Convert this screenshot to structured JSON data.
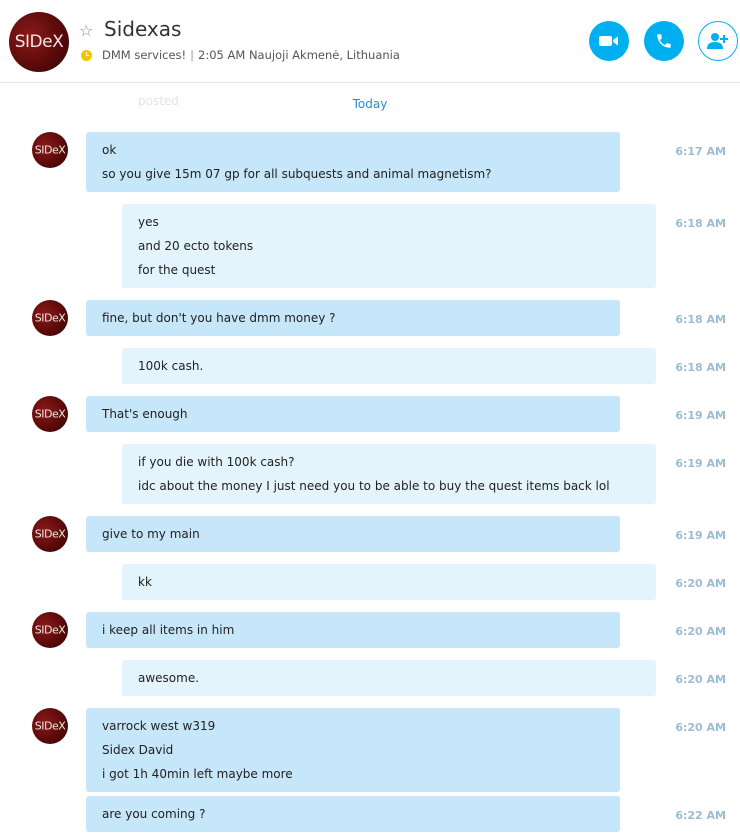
{
  "header": {
    "avatar_text": "SIDeX",
    "name": "Sidexas",
    "status": "DMM services!",
    "local_time": "2:05 AM Naujoji Akmenė, Lithuania",
    "buttons": [
      "video-call",
      "voice-call",
      "add-people"
    ]
  },
  "conversation": {
    "ghost_text": "posted",
    "date_divider": "Today",
    "avatar_text": "SIDeX",
    "messages": [
      {
        "dir": "in",
        "lines": [
          "ok",
          "so you give 15m 07 gp for all subquests and animal magnetism?"
        ],
        "time": "6:17 AM"
      },
      {
        "dir": "out",
        "lines": [
          "yes",
          "and 20 ecto tokens",
          "for the quest"
        ],
        "time": "6:18 AM"
      },
      {
        "dir": "in",
        "lines": [
          "fine, but don't you have dmm money ?"
        ],
        "time": "6:18 AM"
      },
      {
        "dir": "out",
        "lines": [
          "100k cash."
        ],
        "time": "6:18 AM"
      },
      {
        "dir": "in",
        "lines": [
          "That's enough"
        ],
        "time": "6:19 AM"
      },
      {
        "dir": "out",
        "lines": [
          "if you die with 100k cash?",
          "idc about the money I just need you to be able to buy the quest items back lol"
        ],
        "time": "6:19 AM"
      },
      {
        "dir": "in",
        "lines": [
          "give to my main"
        ],
        "time": "6:19 AM"
      },
      {
        "dir": "out",
        "lines": [
          "kk"
        ],
        "time": "6:20 AM"
      },
      {
        "dir": "in",
        "lines": [
          "i keep all items in him"
        ],
        "time": "6:20 AM"
      },
      {
        "dir": "out",
        "lines": [
          "awesome."
        ],
        "time": "6:20 AM"
      },
      {
        "dir": "in",
        "lines": [
          "varrock west w319",
          "Sidex David",
          "i got 1h 40min left maybe more"
        ],
        "time": "6:20 AM"
      },
      {
        "dir": "in",
        "lines": [
          "are you coming ?"
        ],
        "time": "6:22 AM"
      }
    ]
  },
  "colors": {
    "accent": "#00aff0",
    "incoming_bubble": "#c6e6f9",
    "outgoing_bubble": "#e4f4fd",
    "timestamp": "#9bbcd4",
    "status_icon": "#f5c400"
  }
}
